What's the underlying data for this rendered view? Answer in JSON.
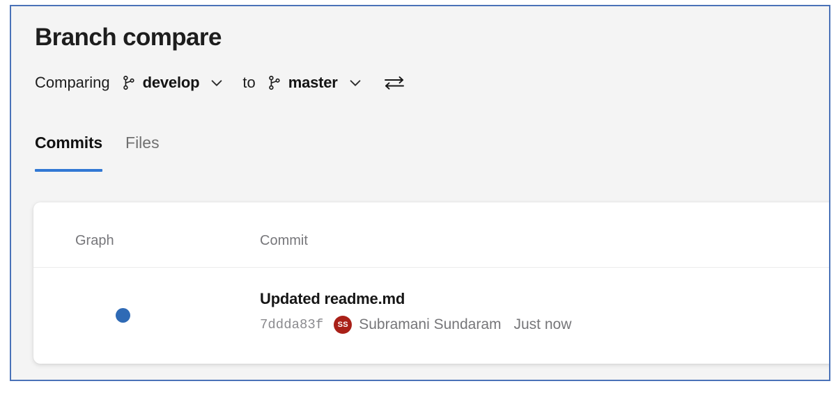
{
  "page": {
    "title": "Branch compare",
    "accent_color": "#3178d4",
    "frame_color": "#4a72b8",
    "background_color": "#f4f4f4",
    "card_color": "#ffffff"
  },
  "compare": {
    "label": "Comparing",
    "to_label": "to",
    "source_branch": {
      "name": "develop",
      "icon": "git-branch-icon",
      "chevron": "chevron-down-icon"
    },
    "target_branch": {
      "name": "master",
      "icon": "git-branch-icon",
      "chevron": "chevron-down-icon"
    },
    "swap_icon": "swap-arrows-icon"
  },
  "tabs": [
    {
      "label": "Commits",
      "active": true
    },
    {
      "label": "Files",
      "active": false
    }
  ],
  "commits_table": {
    "columns": [
      {
        "key": "graph",
        "label": "Graph"
      },
      {
        "key": "commit",
        "label": "Commit"
      }
    ],
    "rows": [
      {
        "graph_dot_color": "#2f6ab5",
        "message": "Updated readme.md",
        "hash": "7ddda83f",
        "author": {
          "initials": "SS",
          "name": "Subramani Sundaram",
          "avatar_color": "#a92018"
        },
        "time": "Just now"
      }
    ]
  }
}
